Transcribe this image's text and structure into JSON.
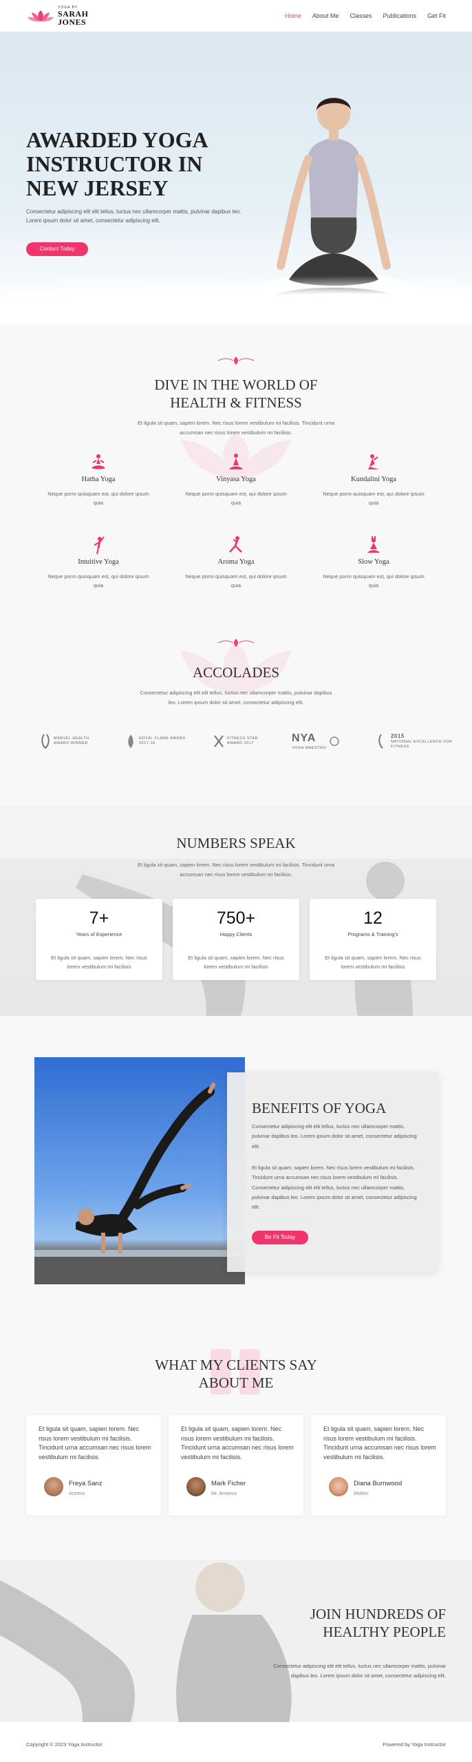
{
  "header": {
    "logo_small": "YOGA BY",
    "logo_line1": "SARAH",
    "logo_line2": "JONES",
    "nav": [
      "Home",
      "About Me",
      "Classes",
      "Publications",
      "Get Fit"
    ],
    "active_nav": "Home"
  },
  "hero": {
    "title": "AWARDED YOGA INSTRUCTOR IN NEW JERSEY",
    "text": "Consectetur adipiscing elit elit tellus, luctus nec ullamcorper mattis, pulvinar dapibus leo. Lorem ipsum dolor sit amet, consectetur adipiscing elit.",
    "button": "Contact Today"
  },
  "dive": {
    "title_line1": "DIVE IN THE WORLD OF",
    "title_line2": "HEALTH & FITNESS",
    "subtitle": "Et ligula sit quam, sapien lorem. Nec risus lorem vestibulum mi facilisis. Tincidunt urna accumsan nec risus lorem vestibulum mi facilisis.",
    "items": [
      {
        "title": "Hatha Yoga",
        "desc": "Neque porro quisquam est, qui dolore ipsum quia",
        "icon": "lotus-pose-icon"
      },
      {
        "title": "Vinyasa Yoga",
        "desc": "Neque porro quisquam est, qui dolore ipsum quia",
        "icon": "seated-pose-icon"
      },
      {
        "title": "Kundalini Yoga",
        "desc": "Neque porro quisquam est, qui dolore ipsum quia",
        "icon": "kneeling-pose-icon"
      },
      {
        "title": "Intuitive Yoga",
        "desc": "Neque porro quisquam est, qui dolore ipsum quia",
        "icon": "tree-pose-icon"
      },
      {
        "title": "Aroma Yoga",
        "desc": "Neque porro quisquam est, qui dolore ipsum quia",
        "icon": "lunge-pose-icon"
      },
      {
        "title": "Slow Yoga",
        "desc": "Neque porro quisquam est, qui dolore ipsum quia",
        "icon": "hands-up-pose-icon"
      }
    ]
  },
  "accolades": {
    "title": "ACCOLADES",
    "text": "Consectetur adipiscing elit elit tellus, luctus nec ullamcorper mattis, pulvinar dapibus leo. Lorem ipsum dolor sit amet, consectetur adipiscing elit.",
    "awards": [
      {
        "line1": "MARVEL HEALTH",
        "line2": "AWARD WINNER"
      },
      {
        "line1": "ROYAL FLAME AWARD",
        "line2": "2017-18"
      },
      {
        "line1": "FITNESS STAR",
        "line2": "AWARD 2017"
      },
      {
        "line1": "NYA",
        "line2": "YOGA MAESTRO"
      },
      {
        "line1": "2015",
        "line2": "NATIONAL EXCELLENCE FOR FITNESS"
      }
    ]
  },
  "numbers": {
    "title": "NUMBERS SPEAK",
    "subtitle": "Et ligula sit quam, sapien lorem. Nec risus lorem vestibulum mi facilisis. Tincidunt urna accumsan nec risus lorem vestibulum mi facilisis.",
    "stats": [
      {
        "num": "7+",
        "label": "Years of Experience",
        "desc": "Et ligula sit quam, sapien lorem. Nec risus lorem vestibulum mi facilisis"
      },
      {
        "num": "750+",
        "label": "Happy Clients",
        "desc": "Et ligula sit quam, sapien lorem. Nec risus lorem vestibulum mi facilisis"
      },
      {
        "num": "12",
        "label": "Programs & Training's",
        "desc": "Et ligula sit quam, sapien lorem. Nec risus lorem vestibulum mi facilisis"
      }
    ]
  },
  "benefits": {
    "title": "BENEFITS OF YOGA",
    "text1": "Consectetur adipiscing elit elit tellus, luctus nec ullamcorper mattis, pulvinar dapibus leo. Lorem ipsum dolor sit amet, consectetur adipiscing elit.",
    "text2": "Et ligula sit quam, sapien lorem. Nec risus lorem vestibulum mi facilisis. Tincidunt urna accumsan nec risus lorem vestibulum mi facilisis. Consectetur adipiscing elit elit tellus, luctus nec ullamcorper mattis, pulvinar dapibus leo. Lorem ipsum dolor sit amet, consectetur adipiscing elit.",
    "button": "Be Fit Today"
  },
  "testimonials": {
    "title_line1": "WHAT MY CLIENTS SAY",
    "title_line2": "ABOUT ME",
    "items": [
      {
        "text": "Et ligula sit quam, sapien lorem. Nec risus lorem vestibulum mi facilisis. Tincidunt urna accumsan nec risus lorem vestibulum mi facilisis.",
        "name": "Freya Sanz",
        "role": "Actress"
      },
      {
        "text": "Et ligula sit quam, sapien lorem. Nec risus lorem vestibulum mi facilisis. Tincidunt urna accumsan nec risus lorem vestibulum mi facilisis.",
        "name": "Mark Ficher",
        "role": "Mr. America"
      },
      {
        "text": "Et ligula sit quam, sapien lorem. Nec risus lorem vestibulum mi facilisis. Tincidunt urna accumsan nec risus lorem vestibulum mi facilisis.",
        "name": "Diana Burnwood",
        "role": "Mother"
      }
    ]
  },
  "join": {
    "title_line1": "JOIN HUNDREDS OF",
    "title_line2": "HEALTHY PEOPLE",
    "text": "Consectetur adipiscing elit elit tellus, luctus nec ullamcorper mattis, pulvinar dapibus leo. Lorem ipsum dolor sit amet, consectetur adipiscing elit."
  },
  "footer": {
    "left": "Copyright © 2023 Yoga Instructor",
    "right": "Powered by Yoga Instructor"
  },
  "colors": {
    "accent": "#f0356b",
    "nav_active": "#ec407a"
  }
}
